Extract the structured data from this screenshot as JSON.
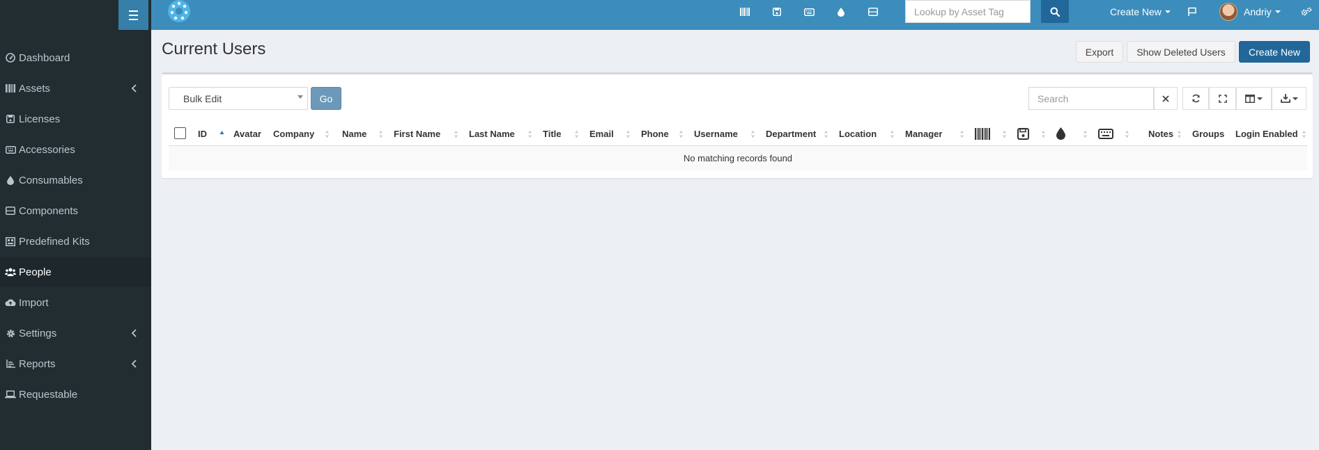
{
  "topbar": {
    "lookup_placeholder": "Lookup by Asset Tag",
    "create_new_label": "Create New",
    "user_name": "Andriy",
    "icons": [
      "barcode-icon",
      "save-icon",
      "keyboard-icon",
      "tint-icon",
      "hdd-icon"
    ]
  },
  "sidebar": {
    "items": [
      {
        "label": "Dashboard",
        "icon": "dashboard-icon",
        "has_children": false,
        "active": false
      },
      {
        "label": "Assets",
        "icon": "barcode-icon",
        "has_children": true,
        "active": false
      },
      {
        "label": "Licenses",
        "icon": "save-icon",
        "has_children": false,
        "active": false
      },
      {
        "label": "Accessories",
        "icon": "keyboard-icon",
        "has_children": false,
        "active": false
      },
      {
        "label": "Consumables",
        "icon": "tint-icon",
        "has_children": false,
        "active": false
      },
      {
        "label": "Components",
        "icon": "hdd-icon",
        "has_children": false,
        "active": false
      },
      {
        "label": "Predefined Kits",
        "icon": "kits-icon",
        "has_children": false,
        "active": false
      },
      {
        "label": "People",
        "icon": "users-icon",
        "has_children": false,
        "active": true
      },
      {
        "label": "Import",
        "icon": "cloud-upload-icon",
        "has_children": false,
        "active": false
      },
      {
        "label": "Settings",
        "icon": "cog-icon",
        "has_children": true,
        "active": false
      },
      {
        "label": "Reports",
        "icon": "chart-icon",
        "has_children": true,
        "active": false
      },
      {
        "label": "Requestable",
        "icon": "laptop-icon",
        "has_children": false,
        "active": false
      }
    ]
  },
  "page": {
    "title": "Current Users",
    "export_label": "Export",
    "show_deleted_label": "Show Deleted Users",
    "create_new_label": "Create New"
  },
  "toolbar": {
    "bulk_edit_label": "Bulk Edit",
    "go_label": "Go",
    "search_placeholder": "Search"
  },
  "table": {
    "columns": [
      "ID",
      "Avatar",
      "Company",
      "Name",
      "First Name",
      "Last Name",
      "Title",
      "Email",
      "Phone",
      "Username",
      "Department",
      "Location",
      "Manager",
      "",
      "",
      "",
      "",
      "Notes",
      "Groups",
      "Login Enabled"
    ],
    "sorted_column": "ID",
    "empty_message": "No matching records found"
  },
  "colors": {
    "topbar": "#3c8dbc",
    "sidebar": "#222d32",
    "primary_button": "#22679a",
    "go_button": "#6c99b9",
    "background": "#ecf0f5"
  }
}
